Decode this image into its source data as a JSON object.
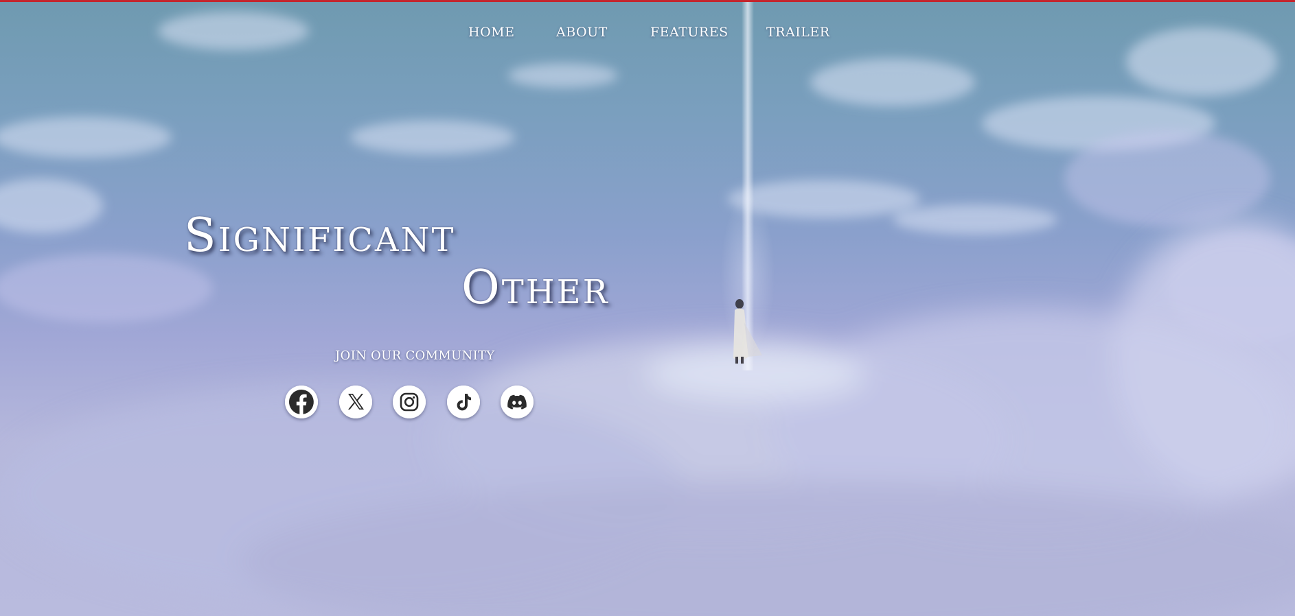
{
  "nav": {
    "items": [
      {
        "label": "HOME"
      },
      {
        "label": "ABOUT"
      },
      {
        "label": "FEATURES"
      },
      {
        "label": "TRAILER"
      }
    ]
  },
  "hero": {
    "title_line1": "Significant",
    "title_line2": "Other",
    "community_label": "JOIN OUR COMMUNITY",
    "socials": [
      {
        "icon": "facebook-icon"
      },
      {
        "icon": "x-twitter-icon"
      },
      {
        "icon": "instagram-icon"
      },
      {
        "icon": "tiktok-icon"
      },
      {
        "icon": "discord-icon"
      }
    ]
  },
  "colors": {
    "top_bar": "#c4262e",
    "sky_top": "#6f9ab0",
    "sky_mid": "#8aa0cc",
    "clouds": "#b9bbde",
    "text": "#ffffff",
    "icon_fill": "#2b2b2b"
  }
}
